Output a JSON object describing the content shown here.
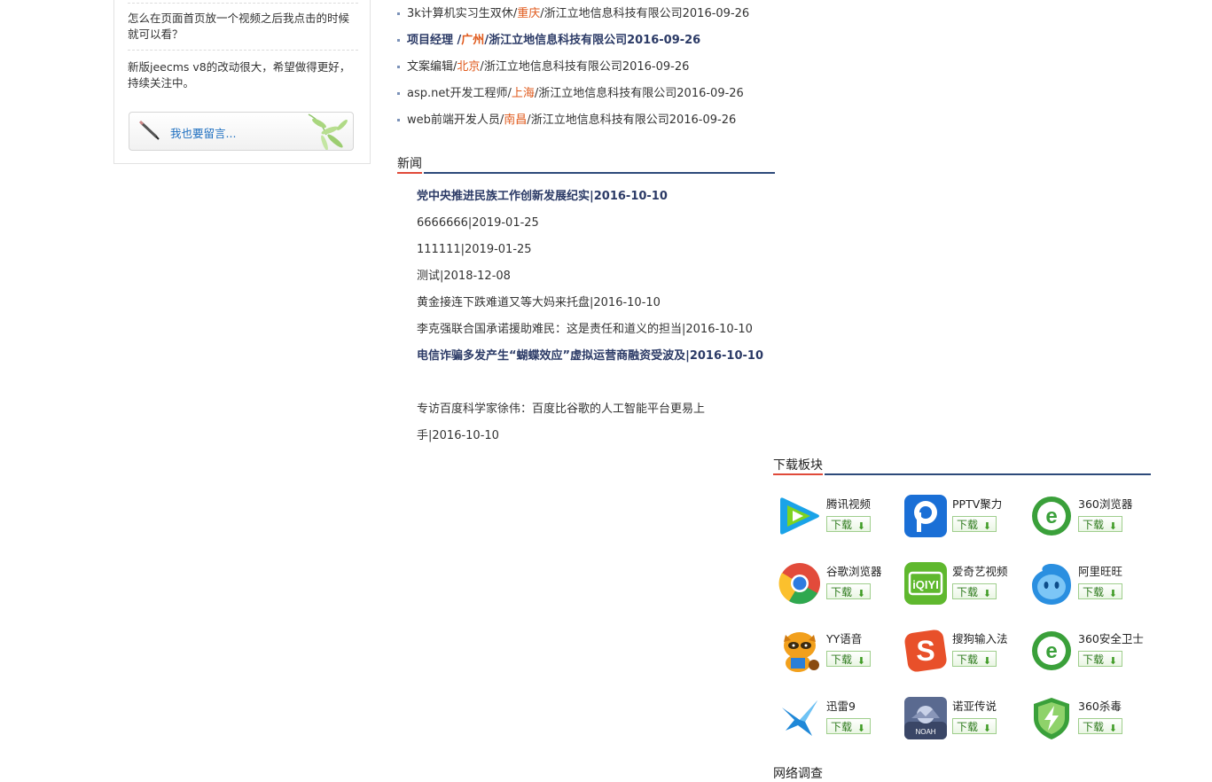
{
  "sidebar": {
    "faq": [
      "怎么在页面首页放一个视频之后我点击的时候就可以看？",
      "新版jeecms  v8的改动很大，希望做得更好，持续关注中。"
    ],
    "leave_message_label": "我也要留言..."
  },
  "jobs": [
    {
      "title": "3k计算机实习生双休",
      "sep1": "/",
      "city": "重庆",
      "sep2": "/",
      "company": "浙江立地信息科技有限公司",
      "date": "2016-09-26",
      "bold": false
    },
    {
      "title": "项目经理",
      "sep1": " /",
      "city": "广州",
      "sep2": "/",
      "company": "浙江立地信息科技有限公司",
      "date": "2016-09-26",
      "bold": true
    },
    {
      "title": "文案编辑",
      "sep1": "/",
      "city": "北京",
      "sep2": "/",
      "company": "浙江立地信息科技有限公司",
      "date": "2016-09-26",
      "bold": false
    },
    {
      "title": "asp.net开发工程师",
      "sep1": "/",
      "city": "上海",
      "sep2": "/",
      "company": "浙江立地信息科技有限公司",
      "date": "2016-09-26",
      "bold": false
    },
    {
      "title": "web前端开发人员",
      "sep1": "/",
      "city": "南昌",
      "sep2": "/",
      "company": "浙江立地信息科技有限公司",
      "date": "2016-09-26",
      "bold": false
    }
  ],
  "news": {
    "title": "新闻",
    "items": [
      {
        "text": "党中央推进民族工作创新发展纪实|2016-10-10",
        "bold": true
      },
      {
        "text": "6666666|2019-01-25",
        "bold": false
      },
      {
        "text": "111111|2019-01-25",
        "bold": false
      },
      {
        "text": "测试|2018-12-08",
        "bold": false
      },
      {
        "text": "黄金接连下跌难道又等大妈来托盘|2016-10-10",
        "bold": false
      },
      {
        "text": "李克强联合国承诺援助难民：这是责任和道义的担当|2016-10-10",
        "bold": false
      },
      {
        "text": "电信诈骗多发产生“蝴蝶效应”虚拟运营商融资受波及|2016-10-10",
        "bold": true
      },
      {
        "text": "专访百度科学家徐伟：百度比谷歌的人工智能平台更易上手|2016-10-10",
        "bold": false
      }
    ]
  },
  "downloads": {
    "title": "下载板块",
    "button_label": "下载",
    "items": [
      {
        "name": "腾讯视频",
        "icon": "tencent-video-icon",
        "color": "#1aa3e8"
      },
      {
        "name": "PPTV聚力",
        "icon": "pptv-icon",
        "color": "#1a6fd6"
      },
      {
        "name": "360浏览器",
        "icon": "360-browser-icon",
        "color": "#3aa03a"
      },
      {
        "name": "谷歌浏览器",
        "icon": "chrome-icon",
        "color": "#e24b3b"
      },
      {
        "name": "爱奇艺视频",
        "icon": "iqiyi-icon",
        "color": "#5fb82e"
      },
      {
        "name": "阿里旺旺",
        "icon": "aliwangwang-icon",
        "color": "#2a8fe0"
      },
      {
        "name": "YY语音",
        "icon": "yy-voice-icon",
        "color": "#f2a01c"
      },
      {
        "name": "搜狗输入法",
        "icon": "sogou-ime-icon",
        "color": "#e8502a"
      },
      {
        "name": "360安全卫士",
        "icon": "360-safe-icon",
        "color": "#3aa03a"
      },
      {
        "name": "迅雷9",
        "icon": "xunlei-icon",
        "color": "#1f88d8"
      },
      {
        "name": "诺亚传说",
        "icon": "noah-legend-icon",
        "color": "#5a6a90"
      },
      {
        "name": "360杀毒",
        "icon": "360-antivirus-icon",
        "color": "#3aa03a"
      }
    ]
  },
  "survey_title": "网络调查"
}
